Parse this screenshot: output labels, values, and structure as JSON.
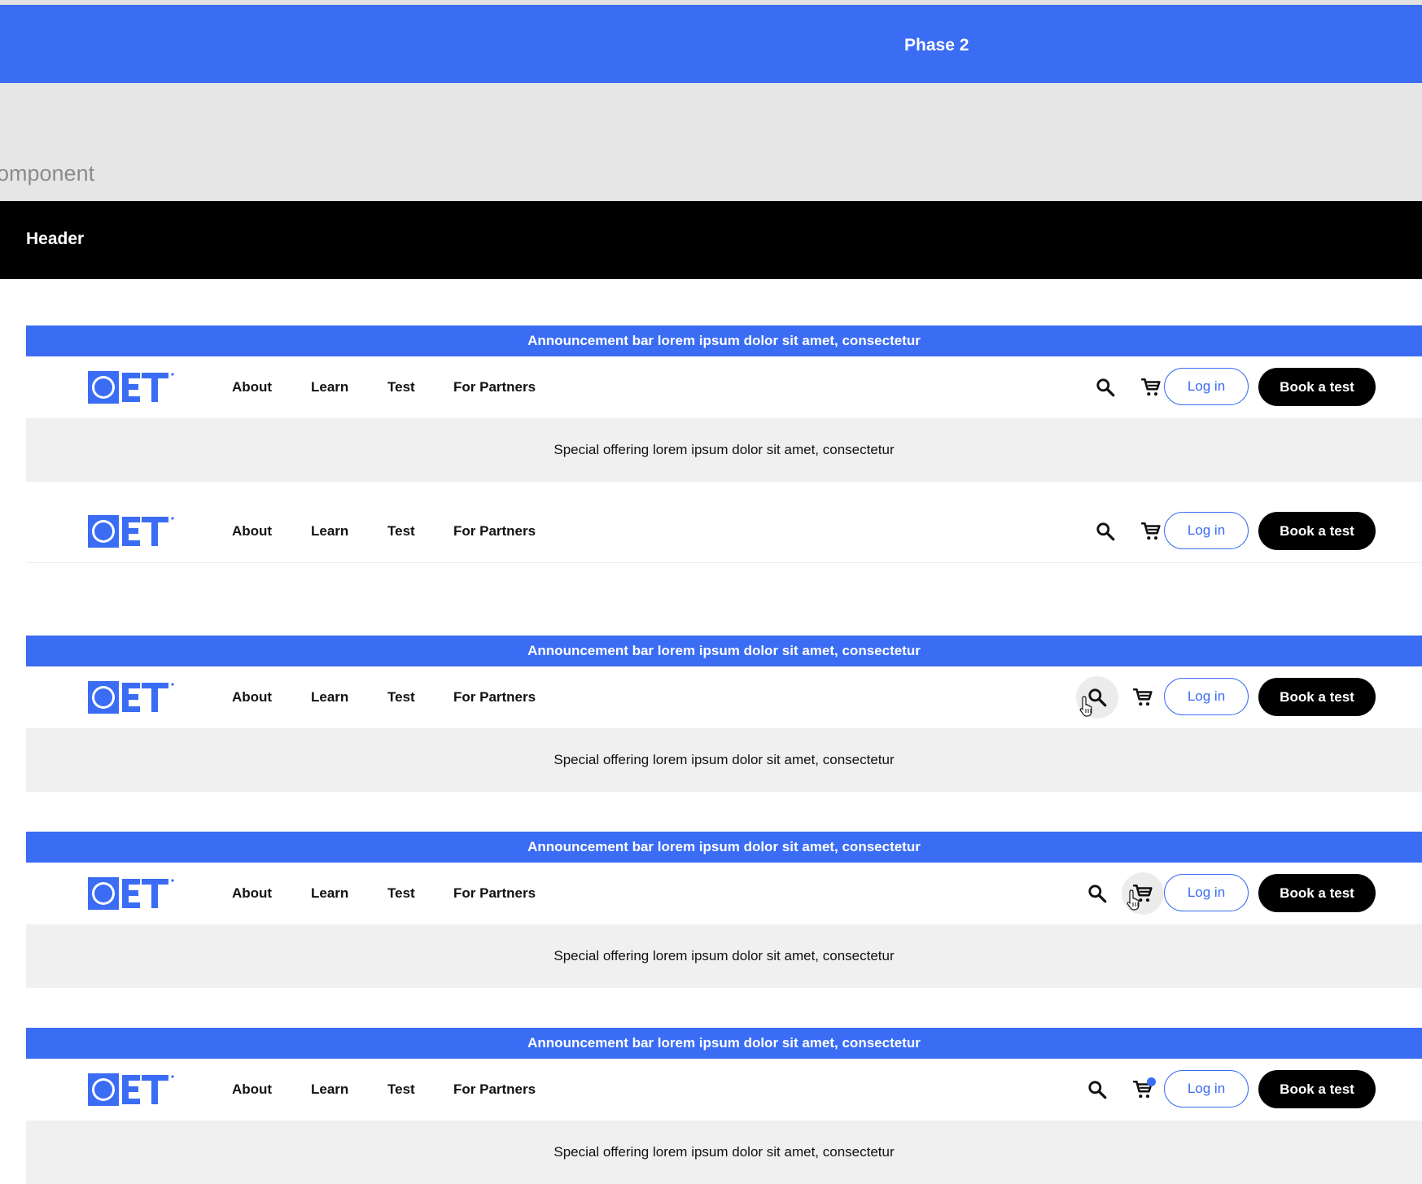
{
  "canvas": {
    "phase_title": "Phase 2",
    "section_label": "omponent"
  },
  "section": {
    "header_label": "Header"
  },
  "brand": {
    "logo_text": "OET",
    "accent": "#3a6cf4",
    "dark": "#000000",
    "special_bg": "#f0f0f0"
  },
  "header": {
    "announcement": "Announcement bar lorem ipsum dolor sit amet, consectetur",
    "special_offering": "Special offering lorem ipsum dolor sit amet, consectetur",
    "nav": [
      {
        "label": "About"
      },
      {
        "label": "Learn"
      },
      {
        "label": "Test"
      },
      {
        "label": "For Partners"
      }
    ],
    "login_label": "Log in",
    "book_label": "Book a test",
    "icons": {
      "search": "search-icon",
      "cart": "cart-icon"
    }
  },
  "variants": [
    {
      "state": "default",
      "announcement": true,
      "special": true
    },
    {
      "state": "minimal",
      "announcement": false,
      "special": false
    },
    {
      "state": "search-hover",
      "announcement": true,
      "special": true
    },
    {
      "state": "cart-hover",
      "announcement": true,
      "special": true
    },
    {
      "state": "cart-badge",
      "announcement": true,
      "special": true
    }
  ]
}
